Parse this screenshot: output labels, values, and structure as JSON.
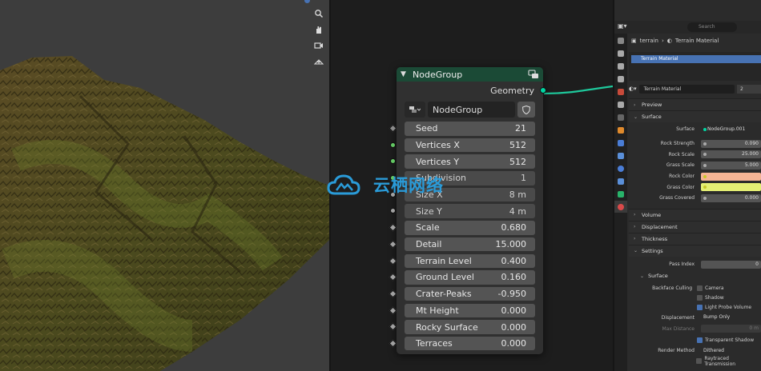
{
  "node": {
    "title": "NodeGroup",
    "output_label": "Geometry",
    "group_name": "NodeGroup",
    "inputs": [
      {
        "label": "Seed",
        "value": "21",
        "socket": "diamond",
        "color": "#8b8b8b",
        "dim": false
      },
      {
        "label": "Vertices X",
        "value": "512",
        "socket": "circle",
        "color": "#63c763",
        "dim": false
      },
      {
        "label": "Vertices Y",
        "value": "512",
        "socket": "circle",
        "color": "#63c763",
        "dim": false
      },
      {
        "label": "Subdivision",
        "value": "1",
        "socket": "circle",
        "color": "#63c763",
        "dim": true
      },
      {
        "label": "Size X",
        "value": "8 m",
        "socket": "circle",
        "color": "#a1a1a1",
        "dim": true
      },
      {
        "label": "Size Y",
        "value": "4 m",
        "socket": "circle",
        "color": "#a1a1a1",
        "dim": true
      },
      {
        "label": "Scale",
        "value": "0.680",
        "socket": "diamond",
        "color": "#a1a1a1",
        "dim": false
      },
      {
        "label": "Detail",
        "value": "15.000",
        "socket": "diamond",
        "color": "#a1a1a1",
        "dim": false
      },
      {
        "label": "Terrain Level",
        "value": "0.400",
        "socket": "diamond",
        "color": "#a1a1a1",
        "dim": false
      },
      {
        "label": "Ground Level",
        "value": "0.160",
        "socket": "diamond",
        "color": "#a1a1a1",
        "dim": false
      },
      {
        "label": "Crater-Peaks",
        "value": "-0.950",
        "socket": "diamond",
        "color": "#a1a1a1",
        "dim": false
      },
      {
        "label": "Mt Height",
        "value": "0.000",
        "socket": "diamond",
        "color": "#a1a1a1",
        "dim": false
      },
      {
        "label": "Rocky Surface",
        "value": "0.000",
        "socket": "diamond",
        "color": "#a1a1a1",
        "dim": false
      },
      {
        "label": "Terraces",
        "value": "0.000",
        "socket": "diamond",
        "color": "#a1a1a1",
        "dim": false
      }
    ]
  },
  "properties": {
    "search_placeholder": "Search",
    "breadcrumb_object": "terrain",
    "breadcrumb_material": "Terrain Material",
    "material_slot": "Terrain Material",
    "material_name": "Terrain Material",
    "material_users": "2",
    "panels": {
      "preview": "Preview",
      "surface": "Surface",
      "volume": "Volume",
      "displacement": "Displacement",
      "thickness": "Thickness",
      "settings": "Settings",
      "surface_sub": "Surface"
    },
    "surface_label": "Surface",
    "surface_value": "NodeGroup.001",
    "surface_props": [
      {
        "label": "Rock Strength",
        "value": "0.090",
        "color": ""
      },
      {
        "label": "Rock Scale",
        "value": "25.000",
        "color": ""
      },
      {
        "label": "Grass Scale",
        "value": "5.000",
        "color": ""
      },
      {
        "label": "Rock Color",
        "value": "",
        "color": "#f5b494"
      },
      {
        "label": "Grass Color",
        "value": "",
        "color": "#e4ef74"
      },
      {
        "label": "Grass Covered",
        "value": "0.000",
        "color": ""
      }
    ],
    "pass_index_label": "Pass Index",
    "pass_index_value": "0",
    "backface_label": "Backface Culling",
    "camera_label": "Camera",
    "shadow_label": "Shadow",
    "light_probe_label": "Light Probe Volume",
    "displacement_label": "Displacement",
    "displacement_value": "Bump Only",
    "max_distance_label": "Max Distance",
    "max_distance_value": "0 m",
    "transparent_shadow_label": "Transparent Shadow",
    "render_method_label": "Render Method",
    "render_method_value": "Dithered",
    "raytraced_label": "Raytraced Transmission"
  },
  "watermark": {
    "text": "云栖网络"
  },
  "colors": {
    "accent": "#4772b3",
    "node_header": "#1b4a36",
    "geometry_socket": "#00d6a3",
    "link": "#1ec99c"
  }
}
